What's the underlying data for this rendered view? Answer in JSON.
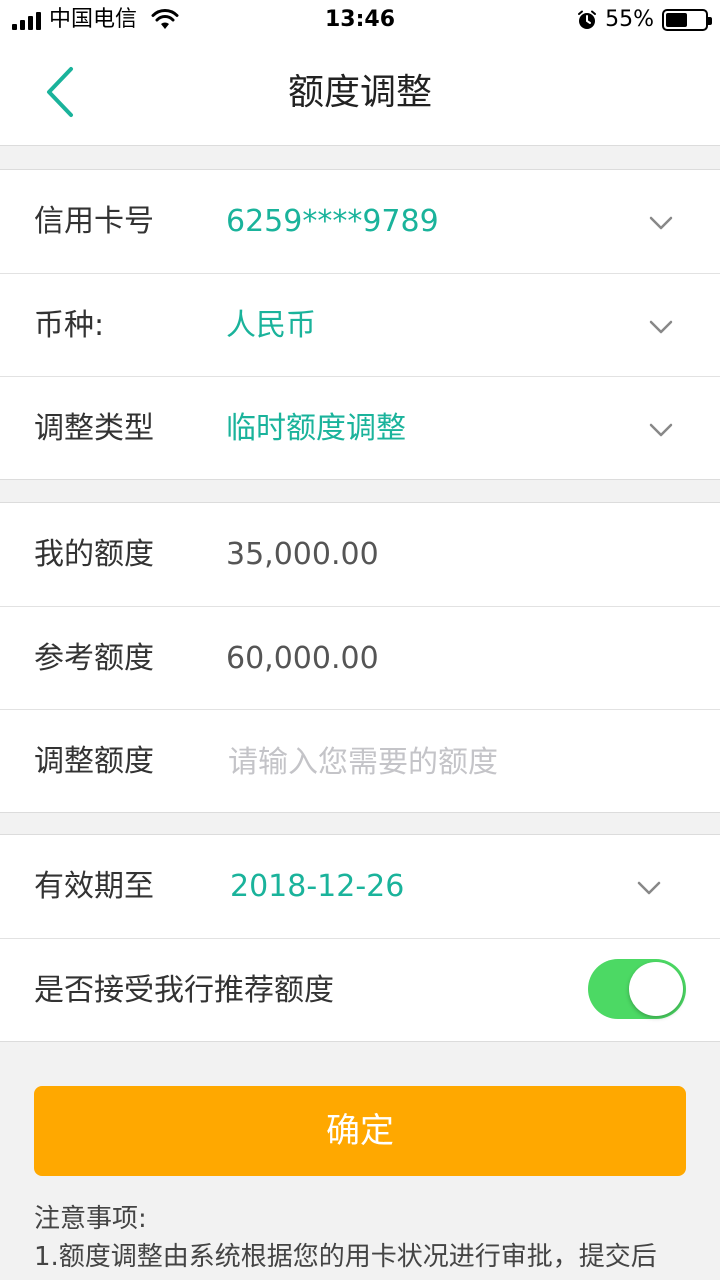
{
  "status_bar": {
    "carrier": "中国电信",
    "time": "13:46",
    "battery_percent": "55%",
    "battery_level": 0.55
  },
  "nav": {
    "title": "额度调整"
  },
  "card_group": {
    "card_number": {
      "label": "信用卡号",
      "value": "6259****9789"
    },
    "currency": {
      "label": "币种:",
      "value": "人民币"
    },
    "adjust_type": {
      "label": "调整类型",
      "value": "临时额度调整"
    }
  },
  "limit_group": {
    "my_limit": {
      "label": "我的额度",
      "value": "35,000.00"
    },
    "reference_limit": {
      "label": "参考额度",
      "value": "60,000.00"
    },
    "adjust_amount": {
      "label": "调整额度",
      "placeholder": "请输入您需要的额度",
      "value": ""
    }
  },
  "validity_group": {
    "valid_until": {
      "label": "有效期至",
      "value": "2018-12-26"
    },
    "accept_recommended": {
      "label": "是否接受我行推荐额度",
      "enabled": true
    }
  },
  "confirm_button": "确定",
  "notes": {
    "title": "注意事项:",
    "line1": "1.额度调整由系统根据您的用卡状况进行审批，提交后"
  },
  "colors": {
    "accent_teal": "#1ab39b",
    "button_orange": "#ffa800",
    "toggle_green": "#4cd964"
  }
}
